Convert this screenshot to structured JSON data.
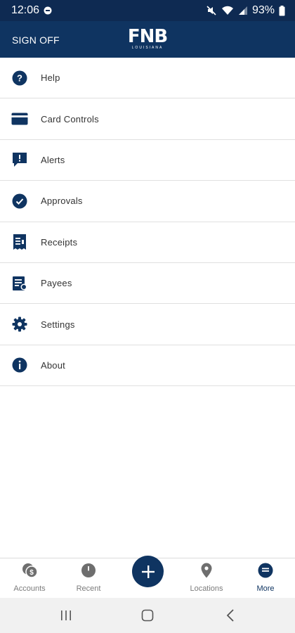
{
  "status_bar": {
    "time": "12:06",
    "battery": "93%"
  },
  "header": {
    "sign_off_label": "SIGN OFF",
    "logo_main": "FNB",
    "logo_sub": "LOUISIANA"
  },
  "menu": {
    "items": [
      {
        "label": "Help",
        "icon": "help-icon"
      },
      {
        "label": "Card Controls",
        "icon": "card-icon"
      },
      {
        "label": "Alerts",
        "icon": "alert-icon"
      },
      {
        "label": "Approvals",
        "icon": "check-icon"
      },
      {
        "label": "Receipts",
        "icon": "receipt-icon"
      },
      {
        "label": "Payees",
        "icon": "payee-icon"
      },
      {
        "label": "Settings",
        "icon": "gear-icon"
      },
      {
        "label": "About",
        "icon": "info-icon"
      }
    ]
  },
  "bottom_nav": {
    "accounts": "Accounts",
    "recent": "Recent",
    "locations": "Locations",
    "more": "More",
    "active": "more"
  },
  "colors": {
    "primary": "#0f3461",
    "status_bar": "#0e2a52",
    "inactive_icon": "#6e6e6e"
  }
}
